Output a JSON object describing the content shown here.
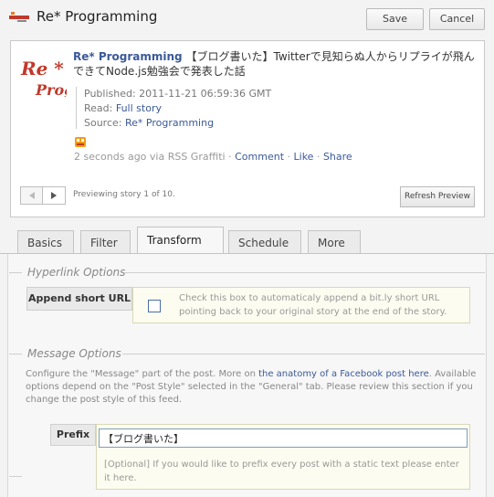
{
  "header": {
    "title": "Re* Programming",
    "save_label": "Save",
    "cancel_label": "Cancel"
  },
  "preview": {
    "logo_text": "Re* Prog",
    "page_name": "Re* Programming",
    "story_title": "【ブログ書いた】Twitterで見知らぬ人からリプライが飛んできてNode.js勉強会で発表した話",
    "published_label": "Published:",
    "published_value": "2011-11-21 06:59:36 GMT",
    "read_label": "Read:",
    "read_link": "Full story",
    "source_label": "Source:",
    "source_link": "Re* Programming",
    "time_text": "2 seconds ago via RSS Graffiti",
    "sep": " · ",
    "comment": "Comment",
    "like": "Like",
    "share": "Share",
    "counter_text": "Previewing story 1 of 10.",
    "refresh_label": "Refresh Preview"
  },
  "tabs": [
    "Basics",
    "Filter",
    "Transform",
    "Schedule",
    "More"
  ],
  "active_tab": "Transform",
  "hyperlink_section": {
    "header": "Hyperlink Options",
    "label": "Append short URL",
    "checked": false,
    "hint": "Check this box to automaticaly append a bit.ly short URL pointing back to your original story at the end of the story."
  },
  "message_section": {
    "header": "Message Options",
    "desc_before": "Configure the \"Message\" part of the post. More on ",
    "desc_link": "the anatomy of a Facebook post here",
    "desc_after": ". Available options depend on the \"Post Style\" selected in the \"General\" tab. Please review this section if you change the post style of this feed.",
    "prefix_label": "Prefix",
    "prefix_value": "【ブログ書いた】",
    "prefix_hint": "[Optional] If you would like to prefix every post with a static text please enter it here."
  },
  "colors": {
    "link": "#3b5998",
    "logo_red": "#c0392b",
    "rss_orange": "#f39c12"
  }
}
